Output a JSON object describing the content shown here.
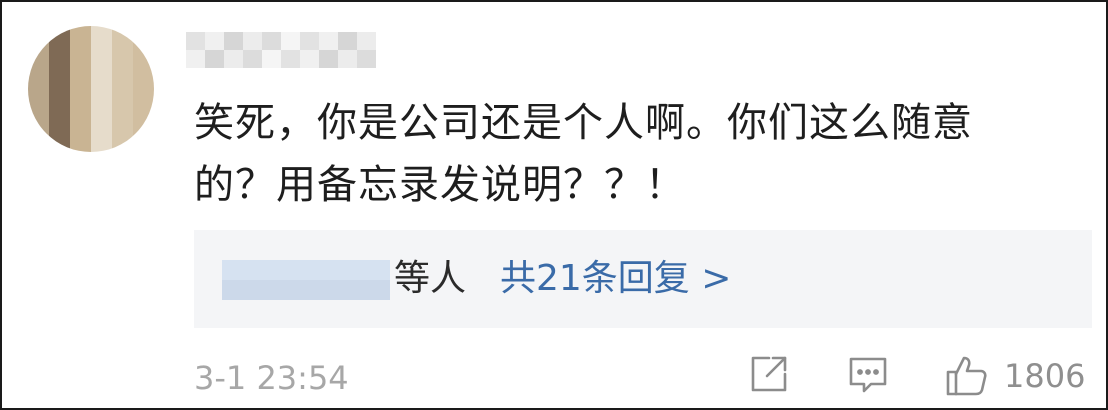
{
  "comment": {
    "text_line1": "笑死，你是公司还是个人啊。你们这么随意",
    "text_line2": "的？用备忘录发说明？？！",
    "replies": {
      "names_suffix": "等人",
      "link_label": "共21条回复 >"
    },
    "timestamp": "3-1 23:54",
    "actions": {
      "share_icon": "share-icon",
      "comment_icon": "comment-icon",
      "like_icon": "thumbs-up-icon",
      "like_count": "1806"
    }
  },
  "colors": {
    "text": "#1e1e1e",
    "link": "#3a6ba8",
    "meta": "#a7a7a7",
    "reply_bg": "#f4f5f7"
  }
}
